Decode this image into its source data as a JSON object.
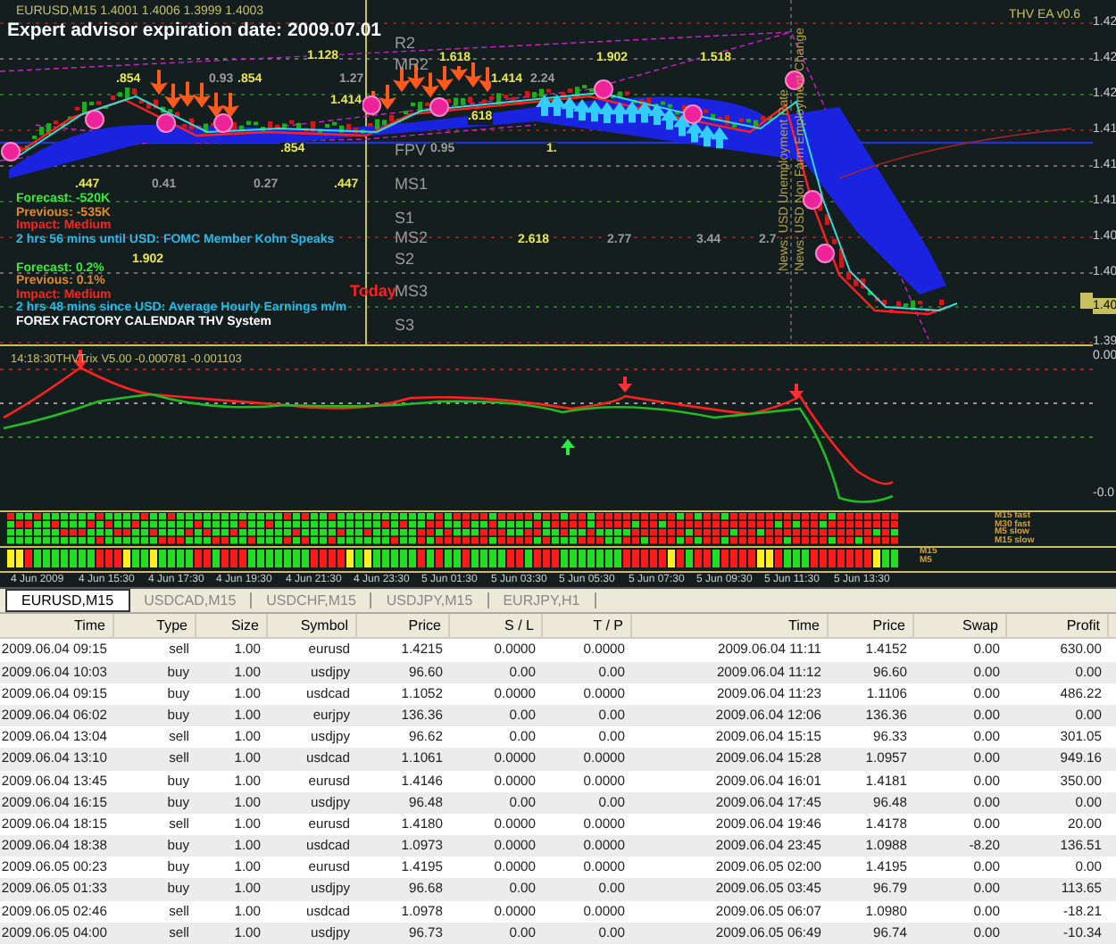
{
  "chart": {
    "symbol_line": "EURUSD,M15  1.4001 1.4006 1.3999 1.4003",
    "expiration": "Expert advisor expiration date:  2009.07.01",
    "ea_label": "THV EA v0.6",
    "pivots": [
      "R2",
      "MR2",
      "FPV",
      "MS1",
      "S1",
      "MS2",
      "S2",
      "MS3",
      "S3"
    ],
    "fib_levels": [
      {
        "text": "1.128",
        "color": "#e8e84a"
      },
      {
        "text": "1.618",
        "color": "#e8e84a"
      },
      {
        "text": "1.902",
        "color": "#e8e84a"
      },
      {
        "text": "1.518",
        "color": "#e8e84a"
      },
      {
        "text": ".854",
        "color": "#e8e84a"
      },
      {
        "text": "0.93",
        "color": "#9a9a9a"
      },
      {
        "text": ".854",
        "color": "#e8e84a"
      },
      {
        "text": "1.27",
        "color": "#9a9a9a"
      },
      {
        "text": "1.414",
        "color": "#e8e84a"
      },
      {
        "text": "2.24",
        "color": "#9a9a9a"
      },
      {
        "text": "1.414",
        "color": "#e8e84a"
      },
      {
        "text": ".618",
        "color": "#e8e84a"
      },
      {
        "text": ".854",
        "color": "#e8e84a"
      },
      {
        "text": "0.95",
        "color": "#9a9a9a"
      },
      {
        "text": "1.",
        "color": "#e8e84a"
      },
      {
        "text": ".447",
        "color": "#e8e84a"
      },
      {
        "text": "0.41",
        "color": "#9a9a9a"
      },
      {
        "text": "0.27",
        "color": "#9a9a9a"
      },
      {
        "text": ".447",
        "color": "#e8e84a"
      },
      {
        "text": "2.618",
        "color": "#e8e84a"
      },
      {
        "text": "2.77",
        "color": "#9a9a9a"
      },
      {
        "text": "3.44",
        "color": "#9a9a9a"
      },
      {
        "text": "2.7",
        "color": "#9a9a9a"
      },
      {
        "text": "1.902",
        "color": "#e8e84a"
      }
    ],
    "news": [
      {
        "text": "Forecast: -520K",
        "color": "#33ee33"
      },
      {
        "text": "Previous: -535K",
        "color": "#e08a2a"
      },
      {
        "text": "Impact: Medium",
        "color": "#ff2020"
      },
      {
        "text": "2 hrs 56 mins until USD: FOMC Member Kohn Speaks",
        "color": "#22bbee"
      },
      {
        "text": "Forecast: 0.2%",
        "color": "#33ee33"
      },
      {
        "text": "Previous: 0.1%",
        "color": "#e08a2a"
      },
      {
        "text": "Impact: Medium",
        "color": "#ff2020"
      },
      {
        "text": "2 hrs 48 mins since USD: Average Hourly Earnings m/m",
        "color": "#22bbee"
      },
      {
        "text": "FOREX FACTORY CALENDAR THV System",
        "color": "#ffffff"
      }
    ],
    "today": "Today",
    "vertical_news": [
      "News: USD Unemployment Rate",
      "News: USD Non Farm Employment Change"
    ],
    "price_axis": [
      "1.42",
      "1.42",
      "1.42",
      "1.41",
      "1.41",
      "1.41",
      "1.40",
      "1.40",
      "1.40",
      "1.39"
    ]
  },
  "indicator": {
    "label": "14:18:30THVTrix V5.00 -0.000781 -0.001103",
    "axis": [
      "0.00",
      "-0.0"
    ],
    "heat_labels": [
      "M15 fast",
      "M30 fast",
      "M5 slow",
      "M15 slow"
    ],
    "heat2_labels": [
      "M15",
      "M5"
    ]
  },
  "time_axis": [
    "4 Jun 2009",
    "4 Jun 15:30",
    "4 Jun 17:30",
    "4 Jun 19:30",
    "4 Jun 21:30",
    "4 Jun 23:30",
    "5 Jun 01:30",
    "5 Jun 03:30",
    "5 Jun 05:30",
    "5 Jun 07:30",
    "5 Jun 09:30",
    "5 Jun 11:30",
    "5 Jun 13:30"
  ],
  "tabs": [
    {
      "label": "EURUSD,M15",
      "selected": true
    },
    {
      "label": "USDCAD,M15",
      "selected": false
    },
    {
      "label": "USDCHF,M15",
      "selected": false
    },
    {
      "label": "USDJPY,M15",
      "selected": false
    },
    {
      "label": "EURJPY,H1",
      "selected": false
    }
  ],
  "table": {
    "columns": [
      "Time",
      "Type",
      "Size",
      "Symbol",
      "Price",
      "S / L",
      "T / P",
      "Time",
      "Price",
      "Swap",
      "Profit"
    ],
    "rows": [
      [
        "2009.06.04 09:15",
        "sell",
        "1.00",
        "eurusd",
        "1.4215",
        "0.0000",
        "0.0000",
        "2009.06.04 11:11",
        "1.4152",
        "0.00",
        "630.00"
      ],
      [
        "2009.06.04 10:03",
        "buy",
        "1.00",
        "usdjpy",
        "96.60",
        "0.00",
        "0.00",
        "2009.06.04 11:12",
        "96.60",
        "0.00",
        "0.00"
      ],
      [
        "2009.06.04 09:15",
        "buy",
        "1.00",
        "usdcad",
        "1.1052",
        "0.0000",
        "0.0000",
        "2009.06.04 11:23",
        "1.1106",
        "0.00",
        "486.22"
      ],
      [
        "2009.06.04 06:02",
        "buy",
        "1.00",
        "eurjpy",
        "136.36",
        "0.00",
        "0.00",
        "2009.06.04 12:06",
        "136.36",
        "0.00",
        "0.00"
      ],
      [
        "2009.06.04 13:04",
        "sell",
        "1.00",
        "usdjpy",
        "96.62",
        "0.00",
        "0.00",
        "2009.06.04 15:15",
        "96.33",
        "0.00",
        "301.05"
      ],
      [
        "2009.06.04 13:10",
        "sell",
        "1.00",
        "usdcad",
        "1.1061",
        "0.0000",
        "0.0000",
        "2009.06.04 15:28",
        "1.0957",
        "0.00",
        "949.16"
      ],
      [
        "2009.06.04 13:45",
        "buy",
        "1.00",
        "eurusd",
        "1.4146",
        "0.0000",
        "0.0000",
        "2009.06.04 16:01",
        "1.4181",
        "0.00",
        "350.00"
      ],
      [
        "2009.06.04 16:15",
        "buy",
        "1.00",
        "usdjpy",
        "96.48",
        "0.00",
        "0.00",
        "2009.06.04 17:45",
        "96.48",
        "0.00",
        "0.00"
      ],
      [
        "2009.06.04 18:15",
        "sell",
        "1.00",
        "eurusd",
        "1.4180",
        "0.0000",
        "0.0000",
        "2009.06.04 19:46",
        "1.4178",
        "0.00",
        "20.00"
      ],
      [
        "2009.06.04 18:38",
        "buy",
        "1.00",
        "usdcad",
        "1.0973",
        "0.0000",
        "0.0000",
        "2009.06.04 23:45",
        "1.0988",
        "-8.20",
        "136.51"
      ],
      [
        "2009.06.05 00:23",
        "buy",
        "1.00",
        "eurusd",
        "1.4195",
        "0.0000",
        "0.0000",
        "2009.06.05 02:00",
        "1.4195",
        "0.00",
        "0.00"
      ],
      [
        "2009.06.05 01:33",
        "buy",
        "1.00",
        "usdjpy",
        "96.68",
        "0.00",
        "0.00",
        "2009.06.05 03:45",
        "96.79",
        "0.00",
        "113.65"
      ],
      [
        "2009.06.05 02:46",
        "sell",
        "1.00",
        "usdcad",
        "1.0978",
        "0.0000",
        "0.0000",
        "2009.06.05 06:07",
        "1.0980",
        "0.00",
        "-18.21"
      ],
      [
        "2009.06.05 04:00",
        "sell",
        "1.00",
        "usdjpy",
        "96.73",
        "0.00",
        "0.00",
        "2009.06.05 06:49",
        "96.74",
        "0.00",
        "-10.34"
      ]
    ]
  }
}
